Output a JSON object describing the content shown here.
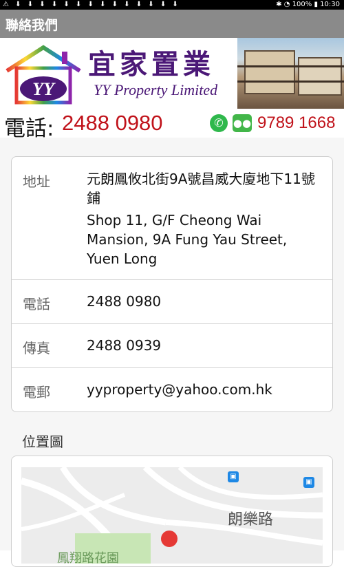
{
  "status_bar": {
    "left_icons": "⚠ ⬇ ⬇ ⬇ ⬇ ⬇ ⬇ ⬇ ⬇ ⬇ ⬇ ⬇ ⬇ ⬇ ⬇",
    "battery": "100%",
    "time": "10:30"
  },
  "app_bar": {
    "title": "聯絡我們"
  },
  "banner": {
    "brand_cn": "宜家置業",
    "brand_en": "YY Property Limited",
    "logo_letters": "YY"
  },
  "phone_bar": {
    "label": "電話:",
    "number": "2488 0980",
    "mobile": "9789 1668"
  },
  "contact": {
    "address_label": "地址",
    "address_cn": "元朗鳳攸北街9A號昌威大廈地下11號鋪",
    "address_en": "Shop 11, G/F Cheong Wai Mansion, 9A Fung Yau Street, Yuen Long",
    "tel_label": "電話",
    "tel_value": "2488 0980",
    "fax_label": "傳真",
    "fax_value": "2488 0939",
    "email_label": "電郵",
    "email_value": "yyproperty@yahoo.com.hk"
  },
  "map": {
    "section_title": "位置圖",
    "road_label": "朗樂路",
    "park_label": "鳳翔路花園"
  },
  "colors": {
    "app_bar": "#8a8a8a",
    "brand": "#4b1877",
    "phone_red": "#c0121a",
    "whatsapp": "#2fb84c",
    "wechat": "#42b649"
  }
}
